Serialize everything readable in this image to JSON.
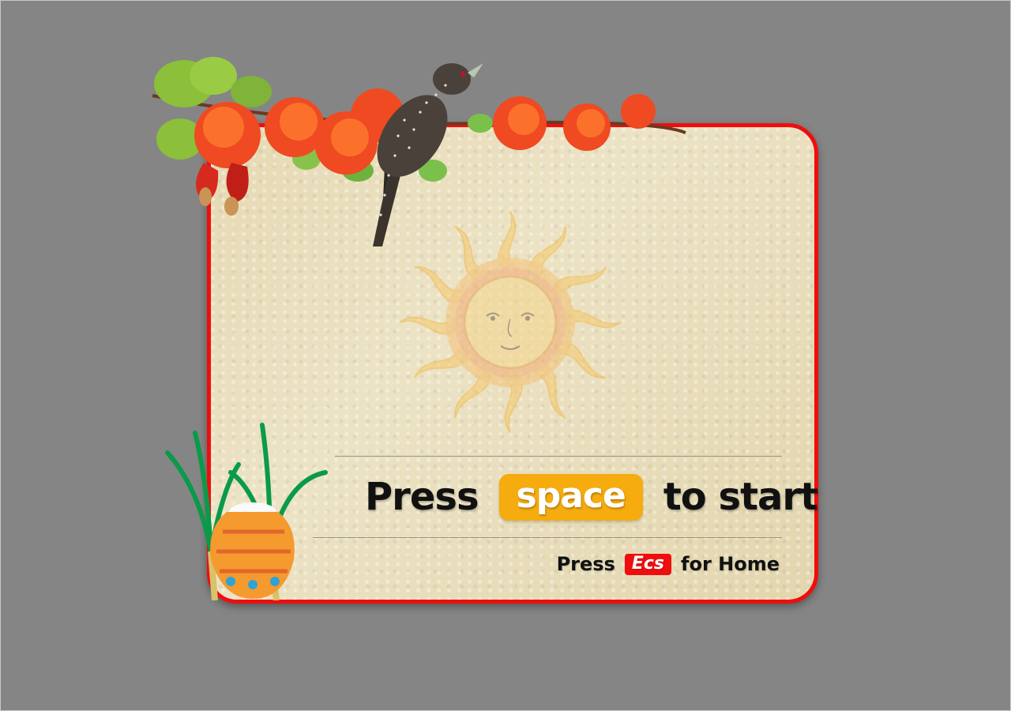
{
  "start_prompt": {
    "prefix": "Press",
    "key_label": "space",
    "suffix": "to start"
  },
  "home_prompt": {
    "prefix": "Press",
    "key_label": "Ecs",
    "suffix": "for Home"
  },
  "colors": {
    "background": "#858585",
    "card_border": "#f00d0d",
    "space_key": "#f6ab0e",
    "ecs_key": "#f00d0d"
  },
  "decorations": {
    "top_left": "flowering-branch-with-leaves",
    "bird": "koel-bird-icon",
    "center": "sun-face-icon",
    "bottom_left": "pongal-pot-with-sugarcane-icon"
  }
}
